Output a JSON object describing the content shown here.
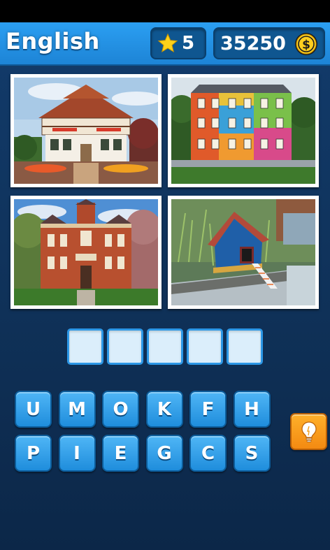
{
  "header": {
    "title": "English",
    "level": "5",
    "coins": "35250",
    "level_icon": "star-icon",
    "coin_icon": "dollar-coin-icon"
  },
  "photos": [
    {
      "subject": "timber-framed house"
    },
    {
      "subject": "painted colorful building"
    },
    {
      "subject": "brick victorian mansion"
    },
    {
      "subject": "duck house"
    }
  ],
  "answer_slots": [
    "",
    "",
    "",
    "",
    ""
  ],
  "letters_row1": [
    "U",
    "M",
    "O",
    "K",
    "F",
    "H"
  ],
  "letters_row2": [
    "P",
    "I",
    "E",
    "G",
    "C",
    "S"
  ],
  "hint": {
    "icon": "lightbulb-icon"
  },
  "colors": {
    "header": "#1d84d6",
    "background": "#0f3158",
    "key": "#2a9be8",
    "hint": "#f39a1b"
  }
}
